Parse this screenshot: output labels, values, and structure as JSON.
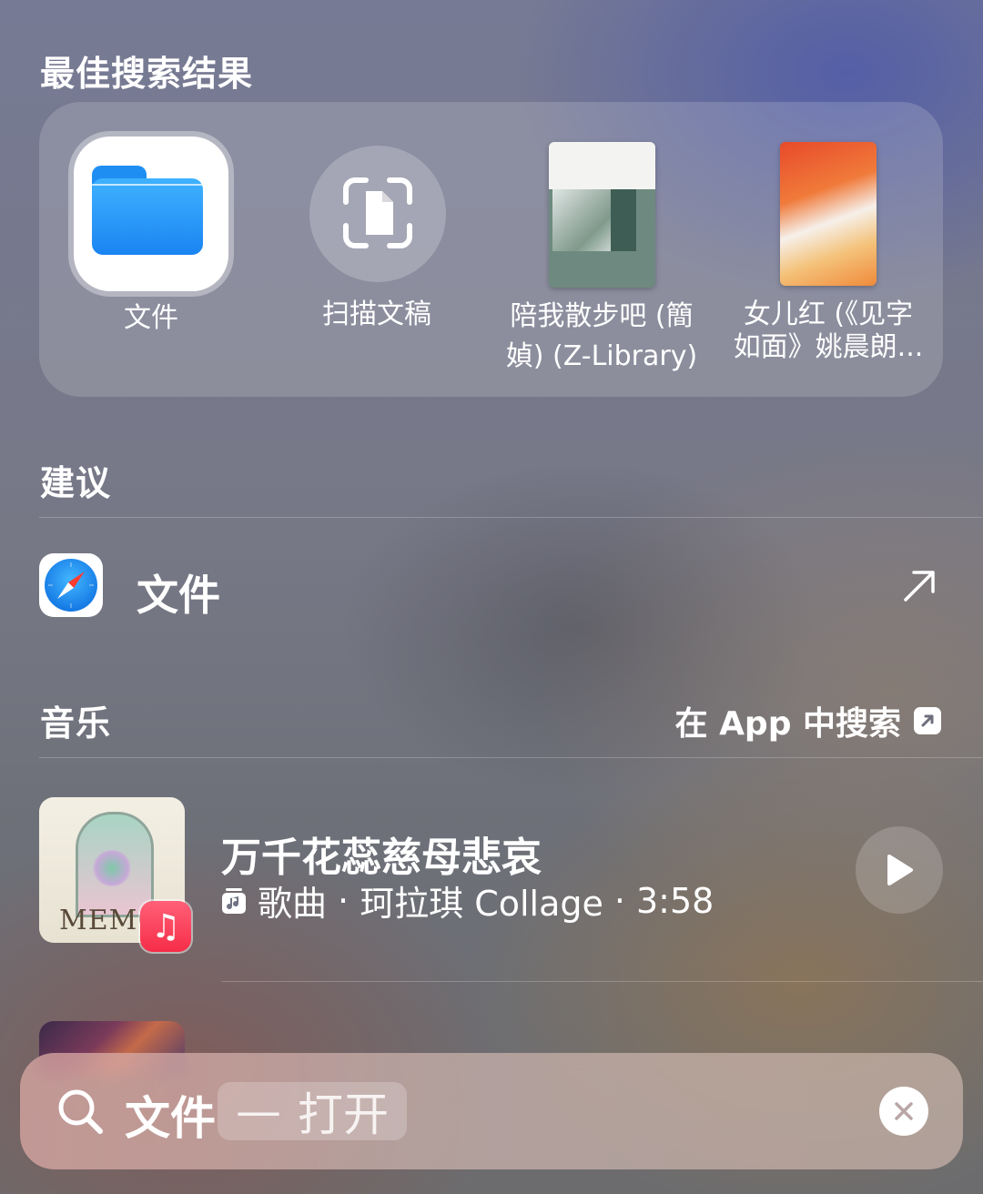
{
  "best_results": {
    "title": "最佳搜索结果",
    "items": [
      {
        "label": "文件",
        "icon": "files-app-icon"
      },
      {
        "label": "扫描文稿",
        "icon": "scan-document-icon"
      },
      {
        "label_line1": "陪我散步吧 (簡",
        "label_line2": "媜) (Z-Library)",
        "icon": "book-cover"
      },
      {
        "label_line1": "女儿红 (《见字",
        "label_line2": "如面》姚晨朗...",
        "icon": "book-cover"
      }
    ]
  },
  "suggestions": {
    "title": "建议",
    "item": {
      "label": "文件",
      "icon": "safari-icon"
    }
  },
  "music": {
    "title": "音乐",
    "search_in_app": "在 App 中搜索",
    "song": {
      "title": "万千花蕊慈母悲哀",
      "type": "歌曲",
      "artist": "珂拉琪 Collage",
      "duration": "3:58",
      "album_text": "MEMO"
    }
  },
  "search": {
    "query": "文件",
    "suggestion_dash": "—",
    "suggestion_action": "打开"
  },
  "colors": {
    "files_blue": "#1a84f2",
    "music_red": "#f72d48",
    "safari_blue": "#1478e4"
  }
}
